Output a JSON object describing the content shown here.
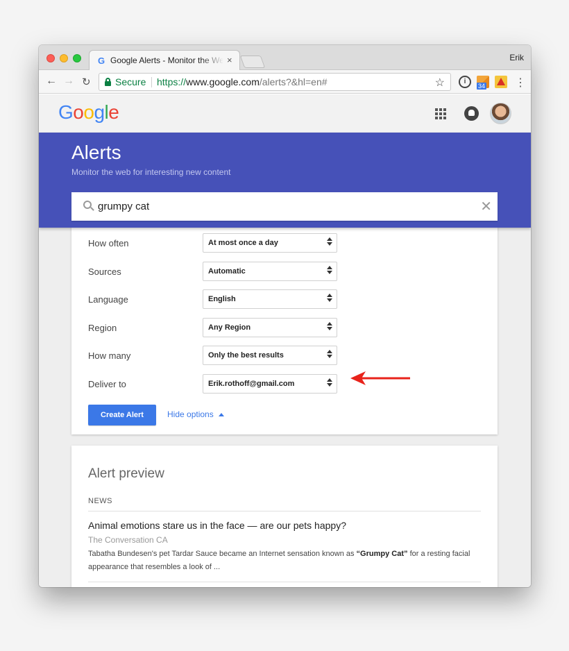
{
  "browser": {
    "tab_title": "Google Alerts - Monitor the Web",
    "profile_name": "Erik",
    "secure_label": "Secure",
    "url_scheme": "https://",
    "url_host": "www.google.com",
    "url_path": "/alerts?&hl=en#",
    "extension_badge": "34"
  },
  "header": {
    "logo": [
      "G",
      "o",
      "o",
      "g",
      "l",
      "e"
    ],
    "logo_colors": [
      "#4285f4",
      "#ea4335",
      "#fbbc05",
      "#4285f4",
      "#34a853",
      "#ea4335"
    ]
  },
  "banner": {
    "title": "Alerts",
    "subtitle": "Monitor the web for interesting new content",
    "search_value": "grumpy cat",
    "color": "#4651b8"
  },
  "options": [
    {
      "label": "How often",
      "value": "At most once a day"
    },
    {
      "label": "Sources",
      "value": "Automatic"
    },
    {
      "label": "Language",
      "value": "English"
    },
    {
      "label": "Region",
      "value": "Any Region"
    },
    {
      "label": "How many",
      "value": "Only the best results"
    },
    {
      "label": "Deliver to",
      "value": "Erik.rothoff@gmail.com"
    }
  ],
  "actions": {
    "create_label": "Create Alert",
    "hide_options_label": "Hide options",
    "accent_color": "#3b78e7"
  },
  "preview": {
    "title": "Alert preview",
    "section": "NEWS",
    "article": {
      "title": "Animal emotions stare us in the face — are our pets happy?",
      "source": "The Conversation CA",
      "snippet_before": "Tabatha Bundesen's pet Tardar Sauce became an Internet sensation known as ",
      "snippet_bold": "“Grumpy Cat”",
      "snippet_after": " for a resting facial appearance that resembles a look of ..."
    }
  },
  "annotation": {
    "arrow_color": "#e8231b",
    "arrow_icon": "arrow-left-icon"
  }
}
